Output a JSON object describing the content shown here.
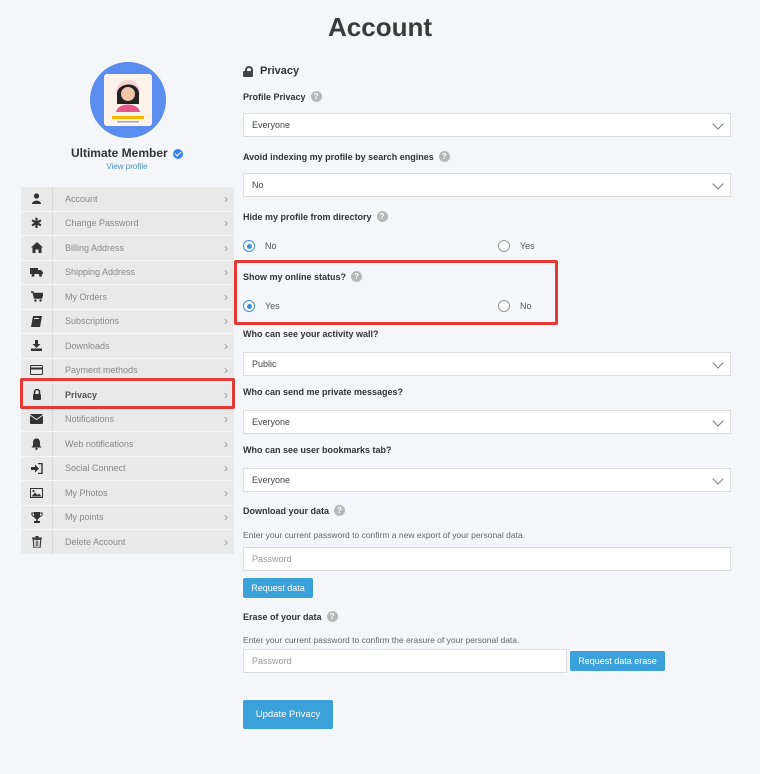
{
  "page": {
    "title": "Account"
  },
  "profile": {
    "name": "Ultimate Member",
    "view_profile": "View profile"
  },
  "nav": {
    "items": [
      {
        "label": "Account",
        "icon": "user-icon",
        "glyph": "👤"
      },
      {
        "label": "Change Password",
        "icon": "asterisk-icon",
        "glyph": "✱"
      },
      {
        "label": "Billing Address",
        "icon": "home-icon",
        "glyph": "⌂"
      },
      {
        "label": "Shipping Address",
        "icon": "truck-icon",
        "glyph": "⛟"
      },
      {
        "label": "My Orders",
        "icon": "cart-icon",
        "glyph": "🛒"
      },
      {
        "label": "Subscriptions",
        "icon": "book-icon",
        "glyph": "▰"
      },
      {
        "label": "Downloads",
        "icon": "download-icon",
        "glyph": "⭳"
      },
      {
        "label": "Payment methods",
        "icon": "credit-card-icon",
        "glyph": "▭"
      },
      {
        "label": "Privacy",
        "icon": "lock-icon",
        "glyph": "🔒"
      },
      {
        "label": "Notifications",
        "icon": "envelope-icon",
        "glyph": "✉"
      },
      {
        "label": "Web notifications",
        "icon": "bell-icon",
        "glyph": "🔔"
      },
      {
        "label": "Social Connect",
        "icon": "sign-in-icon",
        "glyph": "➜"
      },
      {
        "label": "My Photos",
        "icon": "image-icon",
        "glyph": "▨"
      },
      {
        "label": "My points",
        "icon": "trophy-icon",
        "glyph": "🏆"
      },
      {
        "label": "Delete Account",
        "icon": "trash-icon",
        "glyph": "🗑"
      }
    ],
    "active": "Privacy"
  },
  "privacy": {
    "heading": "Privacy",
    "profile_privacy": {
      "label": "Profile Privacy",
      "value": "Everyone"
    },
    "avoid_indexing": {
      "label": "Avoid indexing my profile by search engines",
      "value": "No"
    },
    "hide_directory": {
      "label": "Hide my profile from directory",
      "options": [
        "No",
        "Yes"
      ],
      "selected": "No"
    },
    "online_status": {
      "label": "Show my online status?",
      "options": [
        "Yes",
        "No"
      ],
      "selected": "Yes"
    },
    "activity_wall": {
      "label": "Who can see your activity wall?",
      "value": "Public"
    },
    "private_messages": {
      "label": "Who can send me private messages?",
      "value": "Everyone"
    },
    "bookmarks_tab": {
      "label": "Who can see user bookmarks tab?",
      "value": "Everyone"
    },
    "download_data": {
      "label": "Download your data",
      "help": "Enter your current password to confirm a new export of your personal data.",
      "placeholder": "Password",
      "button": "Request data"
    },
    "erase_data": {
      "label": "Erase of your data",
      "help": "Enter your current password to confirm the erasure of your personal data.",
      "placeholder": "Password",
      "button": "Request data erase"
    },
    "submit": "Update Privacy"
  },
  "colors": {
    "accent": "#3ba1da",
    "highlight": "#e53935"
  }
}
